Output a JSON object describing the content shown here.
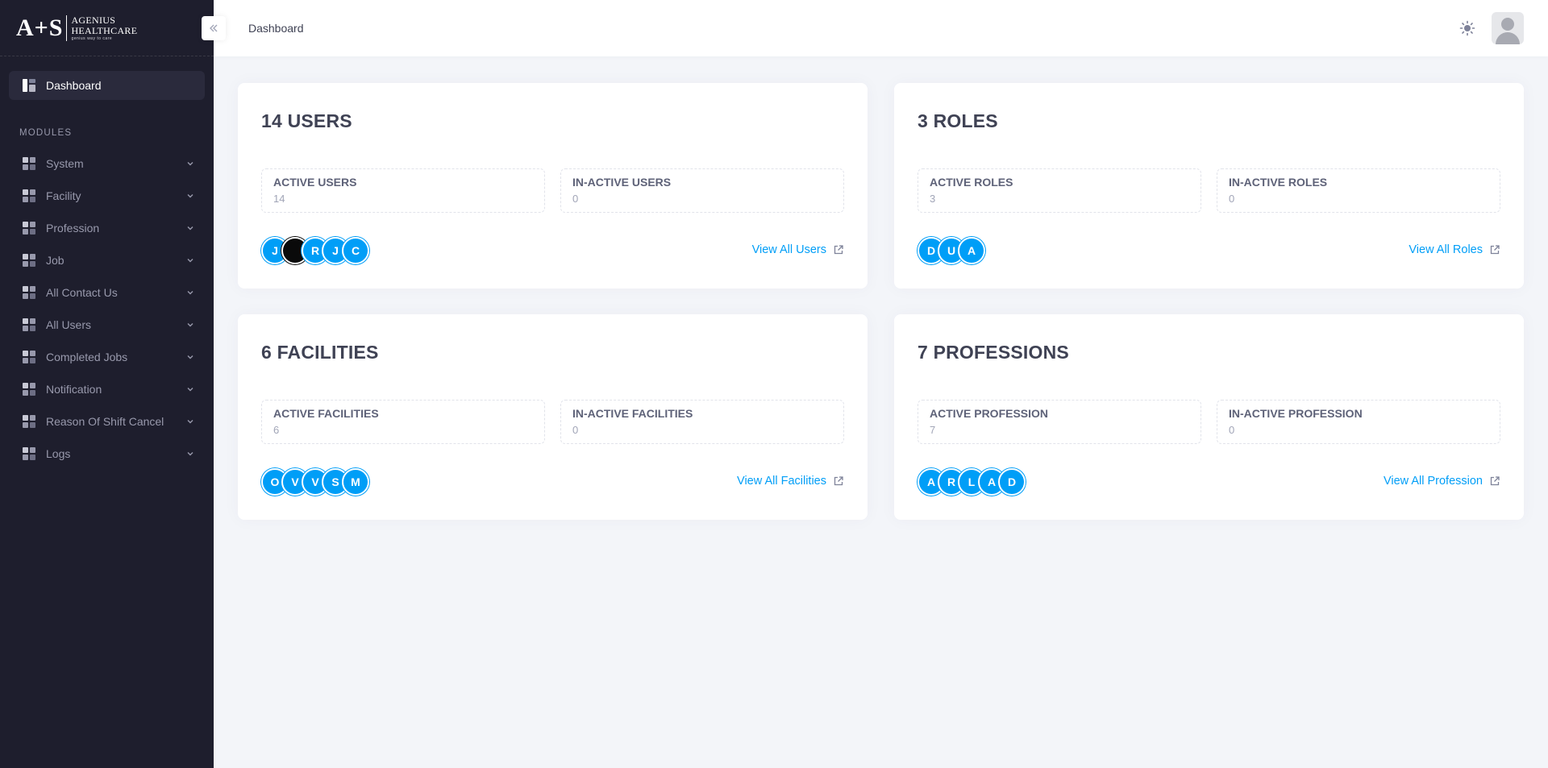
{
  "brand": {
    "mark": "A+S",
    "line1": "AGENIUS",
    "line2": "HEALTHCARE",
    "tagline": "genius way to care"
  },
  "sidebar": {
    "active_item": {
      "label": "Dashboard",
      "icon": "dashboard-icon"
    },
    "section_label": "MODULES",
    "items": [
      {
        "label": "System",
        "icon": "grid-icon"
      },
      {
        "label": "Facility",
        "icon": "grid-icon"
      },
      {
        "label": "Profession",
        "icon": "grid-icon"
      },
      {
        "label": "Job",
        "icon": "grid-icon"
      },
      {
        "label": "All Contact Us",
        "icon": "grid-icon"
      },
      {
        "label": "All Users",
        "icon": "grid-icon"
      },
      {
        "label": "Completed Jobs",
        "icon": "grid-icon"
      },
      {
        "label": "Notification",
        "icon": "grid-icon"
      },
      {
        "label": "Reason Of Shift Cancel",
        "icon": "grid-icon"
      },
      {
        "label": "Logs",
        "icon": "grid-icon"
      }
    ]
  },
  "header": {
    "title": "Dashboard",
    "theme_icon": "sun-icon",
    "avatar_icon": "user-avatar"
  },
  "colors": {
    "sidebar_bg": "#1e1e2d",
    "primary": "#009ef7",
    "page_bg": "#f3f5f9"
  },
  "cards": {
    "users": {
      "title": "14 USERS",
      "active_label": "ACTIVE USERS",
      "active_value": "14",
      "inactive_label": "IN-ACTIVE USERS",
      "inactive_value": "0",
      "avatars": [
        "J",
        "",
        "R",
        "J",
        "C"
      ],
      "link": "View All Users"
    },
    "roles": {
      "title": "3 ROLES",
      "active_label": "ACTIVE ROLES",
      "active_value": "3",
      "inactive_label": "IN-ACTIVE ROLES",
      "inactive_value": "0",
      "avatars": [
        "D",
        "U",
        "A"
      ],
      "link": "View All Roles"
    },
    "facilities": {
      "title": "6 FACILITIES",
      "active_label": "ACTIVE FACILITIES",
      "active_value": "6",
      "inactive_label": "IN-ACTIVE FACILITIES",
      "inactive_value": "0",
      "avatars": [
        "O",
        "V",
        "V",
        "S",
        "M"
      ],
      "link": "View All Facilities"
    },
    "professions": {
      "title": "7 PROFESSIONS",
      "active_label": "ACTIVE PROFESSION",
      "active_value": "7",
      "inactive_label": "IN-ACTIVE PROFESSION",
      "inactive_value": "0",
      "avatars": [
        "A",
        "R",
        "L",
        "A",
        "D"
      ],
      "link": "View All Profession"
    }
  }
}
